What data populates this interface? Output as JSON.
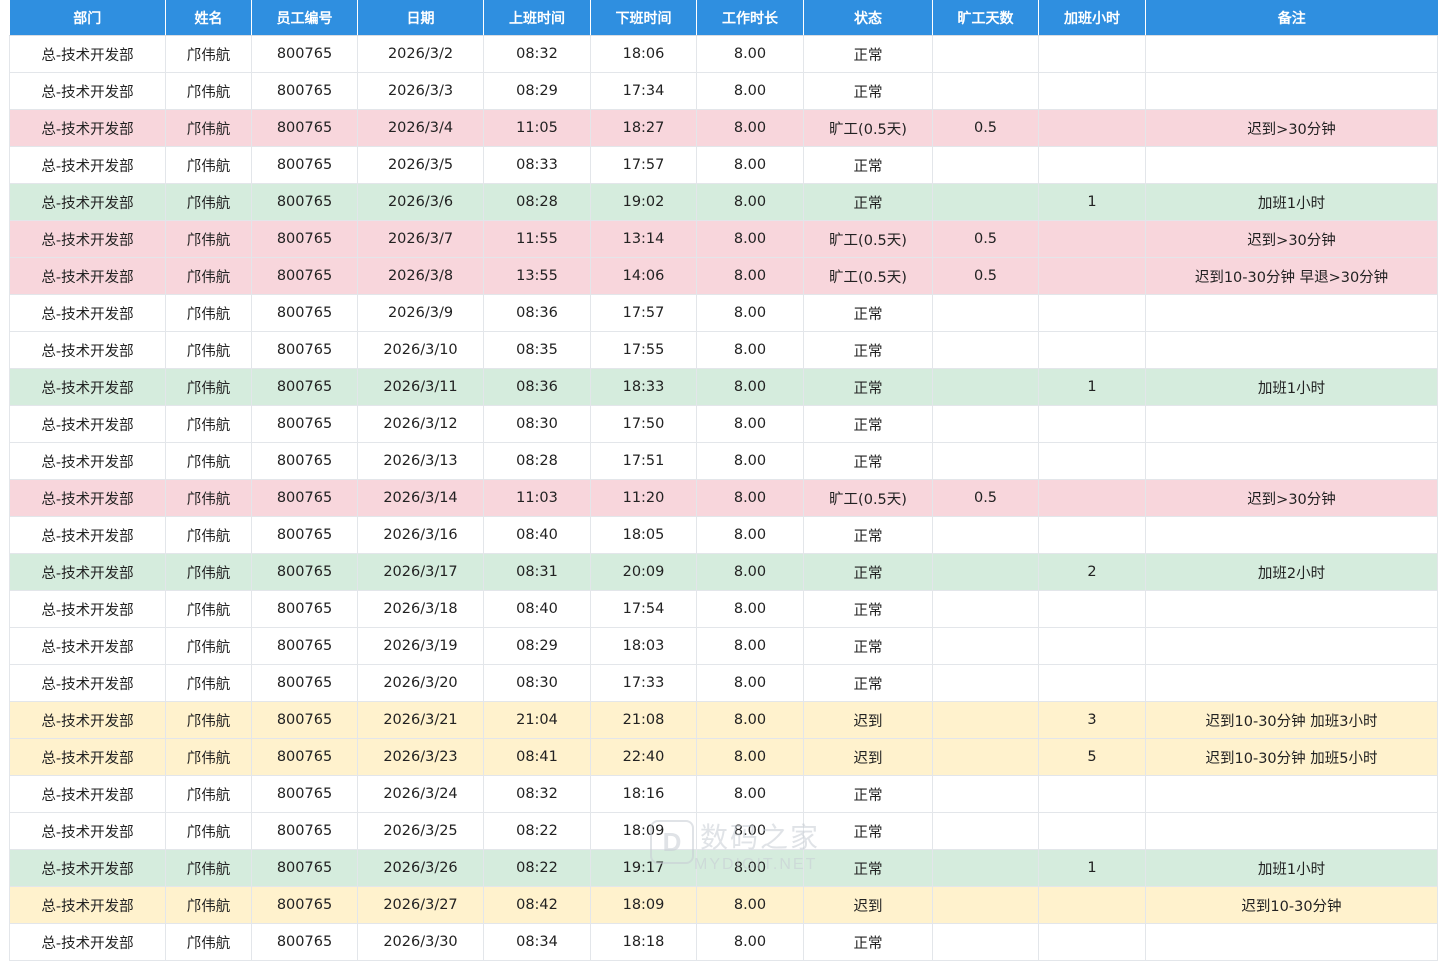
{
  "table": {
    "headers": [
      "部门",
      "姓名",
      "员工编号",
      "日期",
      "上班时间",
      "下班时间",
      "工作时长",
      "状态",
      "旷工天数",
      "加班小时",
      "备注"
    ],
    "rows": [
      {
        "type": "normal",
        "cells": [
          "总-技术开发部",
          "邝伟航",
          "800765",
          "2026/3/2",
          "08:32",
          "18:06",
          "8.00",
          "正常",
          "",
          "",
          ""
        ]
      },
      {
        "type": "normal",
        "cells": [
          "总-技术开发部",
          "邝伟航",
          "800765",
          "2026/3/3",
          "08:29",
          "17:34",
          "8.00",
          "正常",
          "",
          "",
          ""
        ]
      },
      {
        "type": "absent",
        "cells": [
          "总-技术开发部",
          "邝伟航",
          "800765",
          "2026/3/4",
          "11:05",
          "18:27",
          "8.00",
          "旷工(0.5天)",
          "0.5",
          "",
          "迟到>30分钟"
        ]
      },
      {
        "type": "normal",
        "cells": [
          "总-技术开发部",
          "邝伟航",
          "800765",
          "2026/3/5",
          "08:33",
          "17:57",
          "8.00",
          "正常",
          "",
          "",
          ""
        ]
      },
      {
        "type": "overtime",
        "cells": [
          "总-技术开发部",
          "邝伟航",
          "800765",
          "2026/3/6",
          "08:28",
          "19:02",
          "8.00",
          "正常",
          "",
          "1",
          "加班1小时"
        ]
      },
      {
        "type": "absent",
        "cells": [
          "总-技术开发部",
          "邝伟航",
          "800765",
          "2026/3/7",
          "11:55",
          "13:14",
          "8.00",
          "旷工(0.5天)",
          "0.5",
          "",
          "迟到>30分钟"
        ]
      },
      {
        "type": "absent",
        "cells": [
          "总-技术开发部",
          "邝伟航",
          "800765",
          "2026/3/8",
          "13:55",
          "14:06",
          "8.00",
          "旷工(0.5天)",
          "0.5",
          "",
          "迟到10-30分钟 早退>30分钟"
        ]
      },
      {
        "type": "normal",
        "cells": [
          "总-技术开发部",
          "邝伟航",
          "800765",
          "2026/3/9",
          "08:36",
          "17:57",
          "8.00",
          "正常",
          "",
          "",
          ""
        ]
      },
      {
        "type": "normal",
        "cells": [
          "总-技术开发部",
          "邝伟航",
          "800765",
          "2026/3/10",
          "08:35",
          "17:55",
          "8.00",
          "正常",
          "",
          "",
          ""
        ]
      },
      {
        "type": "overtime",
        "cells": [
          "总-技术开发部",
          "邝伟航",
          "800765",
          "2026/3/11",
          "08:36",
          "18:33",
          "8.00",
          "正常",
          "",
          "1",
          "加班1小时"
        ]
      },
      {
        "type": "normal",
        "cells": [
          "总-技术开发部",
          "邝伟航",
          "800765",
          "2026/3/12",
          "08:30",
          "17:50",
          "8.00",
          "正常",
          "",
          "",
          ""
        ]
      },
      {
        "type": "normal",
        "cells": [
          "总-技术开发部",
          "邝伟航",
          "800765",
          "2026/3/13",
          "08:28",
          "17:51",
          "8.00",
          "正常",
          "",
          "",
          ""
        ]
      },
      {
        "type": "absent",
        "cells": [
          "总-技术开发部",
          "邝伟航",
          "800765",
          "2026/3/14",
          "11:03",
          "11:20",
          "8.00",
          "旷工(0.5天)",
          "0.5",
          "",
          "迟到>30分钟"
        ]
      },
      {
        "type": "normal",
        "cells": [
          "总-技术开发部",
          "邝伟航",
          "800765",
          "2026/3/16",
          "08:40",
          "18:05",
          "8.00",
          "正常",
          "",
          "",
          ""
        ]
      },
      {
        "type": "overtime",
        "cells": [
          "总-技术开发部",
          "邝伟航",
          "800765",
          "2026/3/17",
          "08:31",
          "20:09",
          "8.00",
          "正常",
          "",
          "2",
          "加班2小时"
        ]
      },
      {
        "type": "normal",
        "cells": [
          "总-技术开发部",
          "邝伟航",
          "800765",
          "2026/3/18",
          "08:40",
          "17:54",
          "8.00",
          "正常",
          "",
          "",
          ""
        ]
      },
      {
        "type": "normal",
        "cells": [
          "总-技术开发部",
          "邝伟航",
          "800765",
          "2026/3/19",
          "08:29",
          "18:03",
          "8.00",
          "正常",
          "",
          "",
          ""
        ]
      },
      {
        "type": "normal",
        "cells": [
          "总-技术开发部",
          "邝伟航",
          "800765",
          "2026/3/20",
          "08:30",
          "17:33",
          "8.00",
          "正常",
          "",
          "",
          ""
        ]
      },
      {
        "type": "late",
        "cells": [
          "总-技术开发部",
          "邝伟航",
          "800765",
          "2026/3/21",
          "21:04",
          "21:08",
          "8.00",
          "迟到",
          "",
          "3",
          "迟到10-30分钟 加班3小时"
        ]
      },
      {
        "type": "late",
        "cells": [
          "总-技术开发部",
          "邝伟航",
          "800765",
          "2026/3/23",
          "08:41",
          "22:40",
          "8.00",
          "迟到",
          "",
          "5",
          "迟到10-30分钟 加班5小时"
        ]
      },
      {
        "type": "normal",
        "cells": [
          "总-技术开发部",
          "邝伟航",
          "800765",
          "2026/3/24",
          "08:32",
          "18:16",
          "8.00",
          "正常",
          "",
          "",
          ""
        ]
      },
      {
        "type": "normal",
        "cells": [
          "总-技术开发部",
          "邝伟航",
          "800765",
          "2026/3/25",
          "08:22",
          "18:09",
          "8.00",
          "正常",
          "",
          "",
          ""
        ]
      },
      {
        "type": "overtime",
        "cells": [
          "总-技术开发部",
          "邝伟航",
          "800765",
          "2026/3/26",
          "08:22",
          "19:17",
          "8.00",
          "正常",
          "",
          "1",
          "加班1小时"
        ]
      },
      {
        "type": "late",
        "cells": [
          "总-技术开发部",
          "邝伟航",
          "800765",
          "2026/3/27",
          "08:42",
          "18:09",
          "8.00",
          "迟到",
          "",
          "",
          "迟到10-30分钟"
        ]
      },
      {
        "type": "normal",
        "cells": [
          "总-技术开发部",
          "邝伟航",
          "800765",
          "2026/3/30",
          "08:34",
          "18:18",
          "8.00",
          "正常",
          "",
          "",
          ""
        ]
      }
    ]
  },
  "colors": {
    "header": "#2f8fe0",
    "absent_row": "#f8d6dc",
    "overtime_row": "#d5ecdd",
    "late_row": "#fff2cd"
  },
  "watermark": {
    "badge": "D",
    "title": "数码之家",
    "subtitle": "MYDIGIT.NET"
  }
}
